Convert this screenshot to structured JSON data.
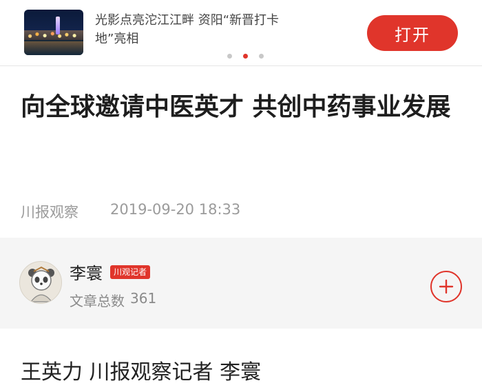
{
  "banner": {
    "text": "光影点亮沱江江畔 资阳“新晋打卡地”亮相",
    "open_label": "打开",
    "thumbnail_icon": "night-city-photo"
  },
  "carousel": {
    "count": 3,
    "active_index": 1
  },
  "article": {
    "title": "向全球邀请中医英才 共创中药事业发展",
    "source": "川报观察",
    "datetime": "2019-09-20 18:33",
    "byline": "王英力 川报观察记者 李寰"
  },
  "author": {
    "name": "李寰",
    "badge": "川观记者",
    "stats_label": "文章总数",
    "stats_value": "361",
    "follow_icon": "plus-icon"
  },
  "colors": {
    "accent": "#e0352b",
    "card_bg": "#f5f5f5",
    "meta_gray": "#9b9b9b"
  }
}
